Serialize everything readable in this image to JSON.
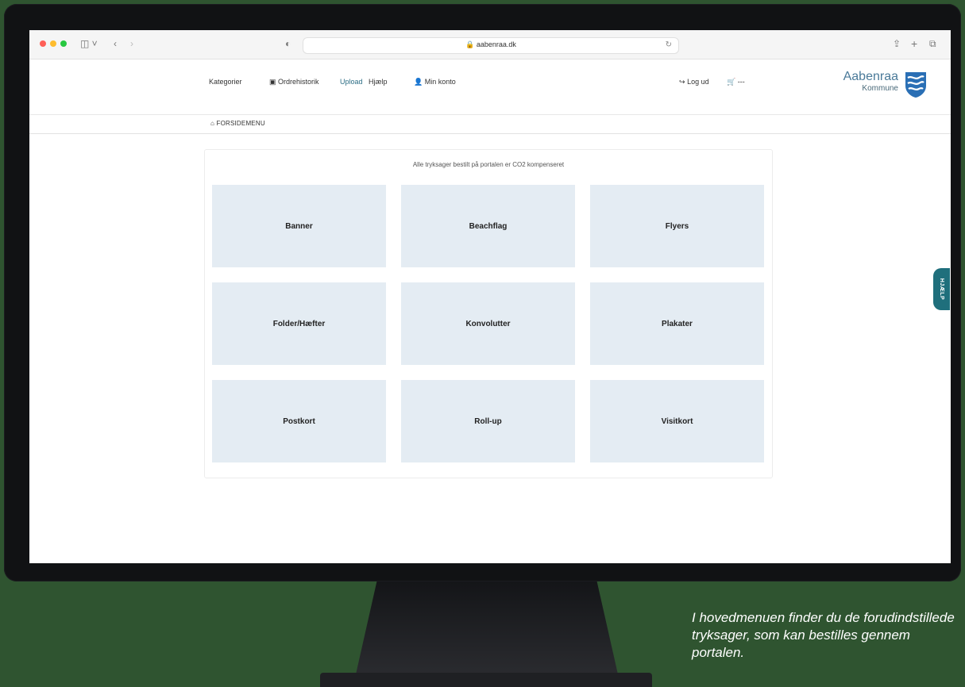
{
  "browser": {
    "url": "aabenraa.dk"
  },
  "header": {
    "nav": {
      "categories": "Kategorier",
      "order_history": "Ordrehistorik",
      "upload": "Upload",
      "help": "Hjælp",
      "account": "Min konto"
    },
    "logout": "Log ud",
    "cart": "---",
    "logo_line1": "Aabenraa",
    "logo_line2": "Kommune"
  },
  "breadcrumb": "FORSIDEMENU",
  "main": {
    "notice": "Alle tryksager bestilt på portalen er CO2 kompenseret",
    "tiles": [
      "Banner",
      "Beachflag",
      "Flyers",
      "Folder/Hæfter",
      "Konvolutter",
      "Plakater",
      "Postkort",
      "Roll-up",
      "Visitkort"
    ]
  },
  "help_tab": "HJÆLP",
  "caption": "I hovedmenuen finder du de forudindstillede tryksager, som kan bestilles gennem portalen.",
  "colors": {
    "background": "#2f5430",
    "tile": "#e4ecf3",
    "help_tab": "#1f6f7c",
    "link": "#2c6e85"
  }
}
